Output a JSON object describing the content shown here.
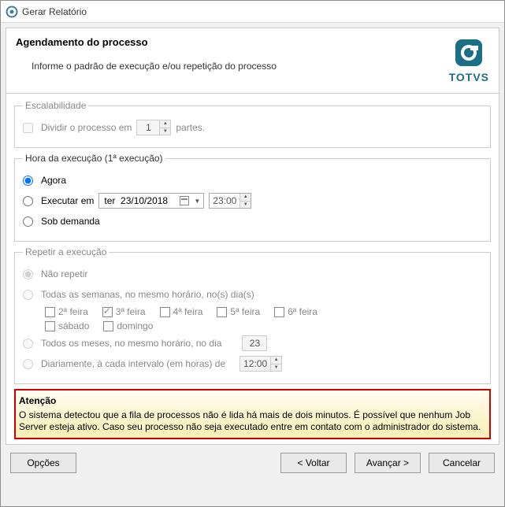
{
  "window": {
    "title": "Gerar Relatório"
  },
  "header": {
    "title": "Agendamento do processo",
    "desc": "Informe o padrão de execução e/ou repetição do processo",
    "logo_text": "TOTVS"
  },
  "escalabilidade": {
    "legend": "Escalabilidade",
    "divide_label": "Dividir o processo em",
    "divide_value": "1",
    "divide_suffix": "partes."
  },
  "execucao": {
    "legend": "Hora da execução (1ª execução)",
    "agora": "Agora",
    "executar_em": "Executar em",
    "date_value": "ter  23/10/2018",
    "time_value": "23:00",
    "sob_demanda": "Sob demanda"
  },
  "repetir": {
    "legend": "Repetir a execução",
    "nao_repetir": "Não repetir",
    "todas_semanas": "Todas as semanas, no mesmo horário, no(s) dia(s)",
    "dias": {
      "seg": "2ª feira",
      "ter": "3ª feira",
      "qua": "4ª feira",
      "qui": "5ª feira",
      "sex": "6ª feira",
      "sab": "sábado",
      "dom": "domingo"
    },
    "todos_meses": "Todos os meses, no mesmo horário, no dia",
    "todos_meses_dia": "23",
    "diariamente": "Diariamente, à cada intervalo (em horas) de",
    "diariamente_valor": "12:00"
  },
  "warning": {
    "title": "Atenção",
    "body": "O sistema detectou que a fila de processos não é lida há mais de dois minutos. É possível que nenhum Job Server esteja ativo. Caso seu processo não seja executado entre em contato com o administrador do sistema."
  },
  "buttons": {
    "opcoes": "Opções",
    "voltar": "< Voltar",
    "avancar": "Avançar >",
    "cancelar": "Cancelar"
  }
}
